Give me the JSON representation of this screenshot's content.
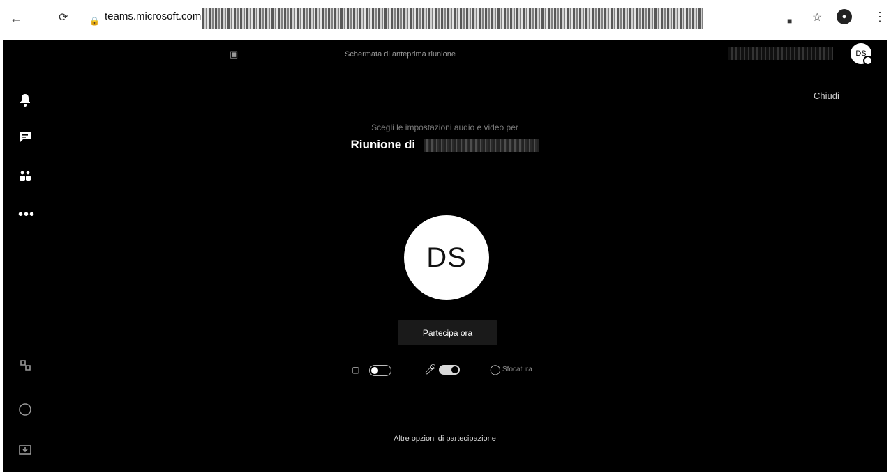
{
  "browser": {
    "url": "teams.microsoft.com"
  },
  "app": {
    "title_bar": "Schermata di anteprima riunione",
    "user_initials": "DS",
    "close_label": "Chiudi",
    "meeting_subtitle": "Scegli le impostazioni audio e video per",
    "meeting_title": "Riunione di",
    "avatar_initials": "DS",
    "join_label": "Partecipa ora",
    "controls": {
      "camera_on": false,
      "mic_on": true,
      "blur_label": "Sfocatura"
    },
    "other_options": "Altre opzioni di partecipazione"
  },
  "colors": {
    "background": "#000000",
    "avatar": "#ffffff",
    "join_button": "#1a1a1a"
  },
  "icons": [
    "back-arrow-icon",
    "reload-icon",
    "lock-icon",
    "extension-icon",
    "star-icon",
    "profile-icon",
    "kebab-icon",
    "bell-icon",
    "chat-icon",
    "teams-icon",
    "more-icon",
    "apps-icon",
    "help-icon",
    "download-icon",
    "camera-icon",
    "mic-icon",
    "blur-icon"
  ]
}
